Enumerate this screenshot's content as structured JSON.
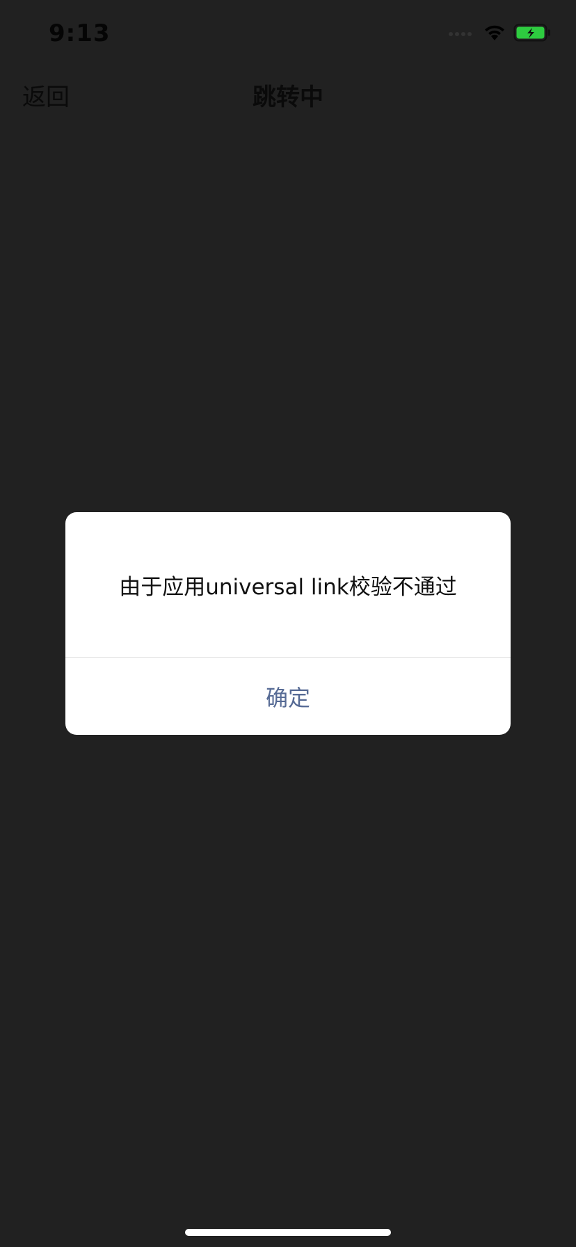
{
  "status_bar": {
    "time": "9:13",
    "wifi_icon": "wifi-icon",
    "battery_icon": "battery-charging-icon",
    "battery_color": "#2ecc40"
  },
  "nav": {
    "back_label": "返回",
    "title": "跳转中"
  },
  "dialog": {
    "message": "由于应用universal link校验不通过",
    "confirm_label": "确定",
    "confirm_color": "#576b95"
  },
  "colors": {
    "background": "#212121",
    "dialog_bg": "#ffffff"
  }
}
